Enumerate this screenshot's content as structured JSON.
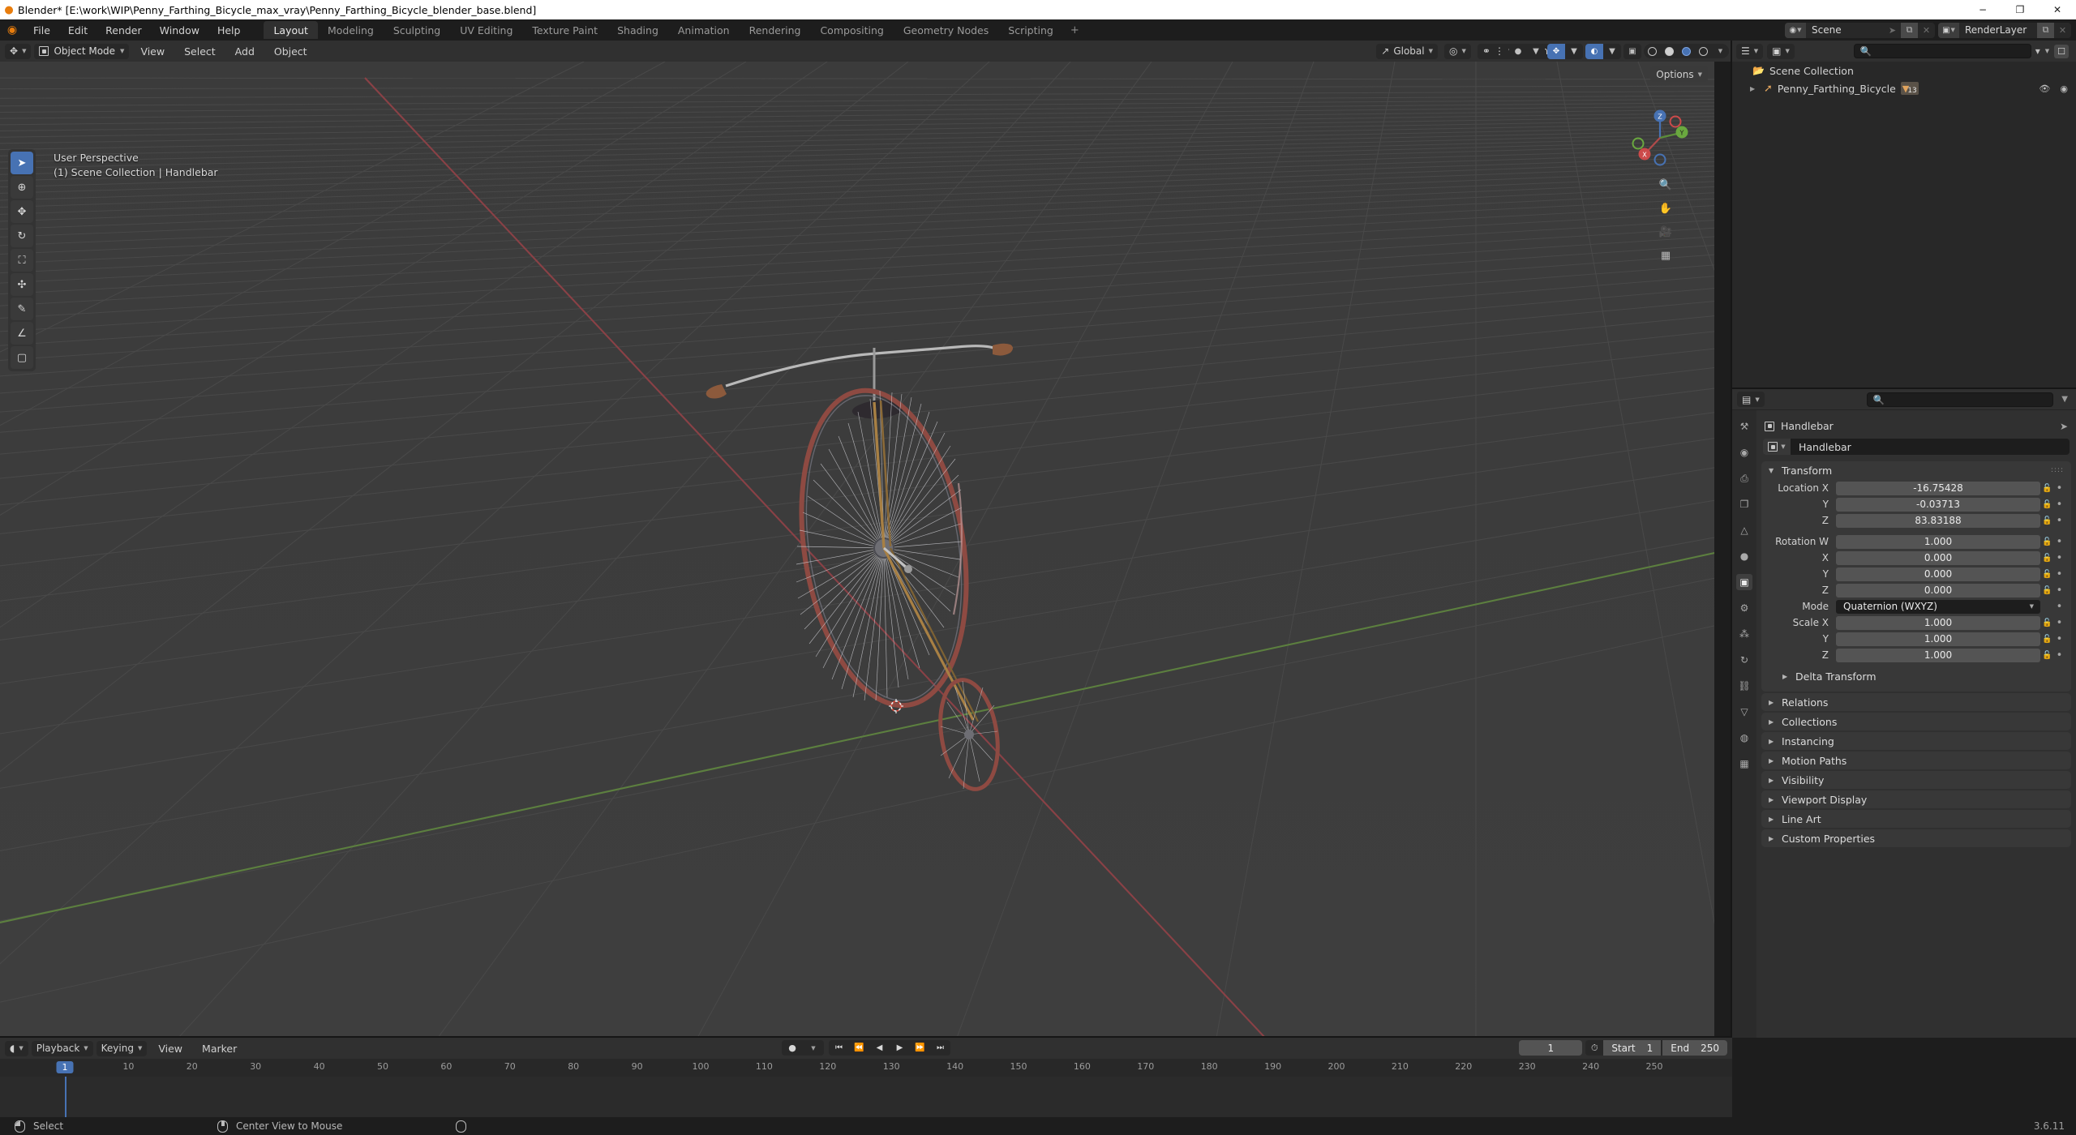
{
  "window": {
    "title": "Blender* [E:\\work\\WIP\\Penny_Farthing_Bicycle_max_vray\\Penny_Farthing_Bicycle_blender_base.blend]",
    "minimize": "−",
    "maximize": "❐",
    "close": "✕"
  },
  "topbar": {
    "menus": [
      "File",
      "Edit",
      "Render",
      "Window",
      "Help"
    ],
    "workspaces": [
      "Layout",
      "Modeling",
      "Sculpting",
      "UV Editing",
      "Texture Paint",
      "Shading",
      "Animation",
      "Rendering",
      "Compositing",
      "Geometry Nodes",
      "Scripting"
    ],
    "active_workspace": "Layout",
    "add_workspace": "+",
    "scene_name": "Scene",
    "viewlayer_name": "RenderLayer",
    "new_scene_label": "⧉",
    "unlink_label": "✕",
    "pin_label": "➤"
  },
  "viewport_header": {
    "editor_type": "editor-type-3dview",
    "mode": "Object Mode",
    "menus": [
      "View",
      "Select",
      "Add",
      "Object"
    ],
    "transform_orientation": "Global",
    "pivot_icon": "pivot-icon",
    "snap_icon": "snap-magnet-icon",
    "proportional_icon": "proportional-edit-icon",
    "options_label": "Options"
  },
  "viewport": {
    "perspective_line": "User Perspective",
    "collection_line": "(1) Scene Collection | Handlebar",
    "gizmo_axes": [
      "X",
      "Y",
      "Z"
    ],
    "tools": [
      {
        "name": "tweak-tool",
        "glyph": "➤",
        "active": true
      },
      {
        "name": "cursor-tool",
        "glyph": "⊕",
        "active": false
      },
      {
        "name": "move-tool",
        "glyph": "✥",
        "active": false
      },
      {
        "name": "rotate-tool",
        "glyph": "↻",
        "active": false
      },
      {
        "name": "scale-tool",
        "glyph": "⛶",
        "active": false
      },
      {
        "name": "transform-tool",
        "glyph": "✣",
        "active": false
      },
      {
        "name": "annotate-tool",
        "glyph": "✎",
        "active": false
      },
      {
        "name": "measure-tool",
        "glyph": "∠",
        "active": false
      },
      {
        "name": "add-cube-tool",
        "glyph": "▢",
        "active": false
      }
    ]
  },
  "outliner": {
    "search_placeholder": "",
    "display_mode_icon": "view-layer-icon",
    "filter_icon": "filter-funnel-icon",
    "new_collection_icon": "new-collection-icon",
    "rows": [
      {
        "label": "Scene Collection",
        "type": "collection",
        "indent": 0,
        "badge": null
      },
      {
        "label": "Penny_Farthing_Bicycle",
        "type": "object",
        "indent": 1,
        "badge": "13"
      }
    ]
  },
  "properties": {
    "breadcrumb_object": "Handlebar",
    "object_name": "Handlebar",
    "tabs": [
      {
        "name": "tool-tab",
        "glyph": "⚒",
        "active": false
      },
      {
        "name": "render-tab",
        "glyph": "◉",
        "active": false
      },
      {
        "name": "output-tab",
        "glyph": "⎙",
        "active": false
      },
      {
        "name": "view-layer-tab",
        "glyph": "❐",
        "active": false
      },
      {
        "name": "scene-tab",
        "glyph": "△",
        "active": false
      },
      {
        "name": "world-tab",
        "glyph": "●",
        "active": false
      },
      {
        "name": "object-tab",
        "glyph": "▣",
        "active": true
      },
      {
        "name": "modifier-tab",
        "glyph": "⚙",
        "active": false
      },
      {
        "name": "particles-tab",
        "glyph": "⁂",
        "active": false
      },
      {
        "name": "physics-tab",
        "glyph": "↻",
        "active": false
      },
      {
        "name": "constraints-tab",
        "glyph": "⛓",
        "active": false
      },
      {
        "name": "data-tab",
        "glyph": "▽",
        "active": false
      },
      {
        "name": "material-tab",
        "glyph": "◍",
        "active": false
      },
      {
        "name": "texture-tab",
        "glyph": "▦",
        "active": false
      }
    ],
    "transform": {
      "panel_label": "Transform",
      "rows": [
        {
          "label": "Location X",
          "value": "-16.75428"
        },
        {
          "label": "Y",
          "value": "-0.03713"
        },
        {
          "label": "Z",
          "value": "83.83188"
        }
      ],
      "rotation_rows": [
        {
          "label": "Rotation W",
          "value": "1.000"
        },
        {
          "label": "X",
          "value": "0.000"
        },
        {
          "label": "Y",
          "value": "0.000"
        },
        {
          "label": "Z",
          "value": "0.000"
        }
      ],
      "mode_label": "Mode",
      "mode_value": "Quaternion (WXYZ)",
      "scale_rows": [
        {
          "label": "Scale X",
          "value": "1.000"
        },
        {
          "label": "Y",
          "value": "1.000"
        },
        {
          "label": "Z",
          "value": "1.000"
        }
      ]
    },
    "collapsed_panels": [
      "Delta Transform",
      "Relations",
      "Collections",
      "Instancing",
      "Motion Paths",
      "Visibility",
      "Viewport Display",
      "Line Art",
      "Custom Properties"
    ]
  },
  "timeline": {
    "editor_icon": "timeline-editor-icon",
    "menus": [
      "Playback",
      "Keying",
      "View",
      "Marker"
    ],
    "record_glyph": "●",
    "transport": [
      {
        "name": "jump-to-start-button",
        "glyph": "⏮"
      },
      {
        "name": "previous-keyframe-button",
        "glyph": "⏪"
      },
      {
        "name": "play-reverse-button",
        "glyph": "◀"
      },
      {
        "name": "play-button",
        "glyph": "▶"
      },
      {
        "name": "next-keyframe-button",
        "glyph": "⏩"
      },
      {
        "name": "jump-to-end-button",
        "glyph": "⏭"
      }
    ],
    "current_frame": "1",
    "start_label": "Start",
    "start_value": "1",
    "end_label": "End",
    "end_value": "250",
    "ticks": [
      10,
      20,
      30,
      40,
      50,
      60,
      70,
      80,
      90,
      100,
      110,
      120,
      130,
      140,
      150,
      160,
      170,
      180,
      190,
      200,
      210,
      220,
      230,
      240,
      250
    ],
    "playhead_frame": "1"
  },
  "statusbar": {
    "left_items": [
      {
        "icon": "mouse-left-icon",
        "label": "Select"
      },
      {
        "icon": "mouse-middle-icon",
        "label": "Center View to Mouse"
      },
      {
        "icon": "mouse-right-icon",
        "label": ""
      }
    ],
    "version": "3.6.11"
  },
  "colors": {
    "accent": "#4772b3",
    "orange": "#e87d0d",
    "viewport_bg": "#3b3b3b",
    "panel_bg": "#303030",
    "field_bg": "#545454"
  }
}
